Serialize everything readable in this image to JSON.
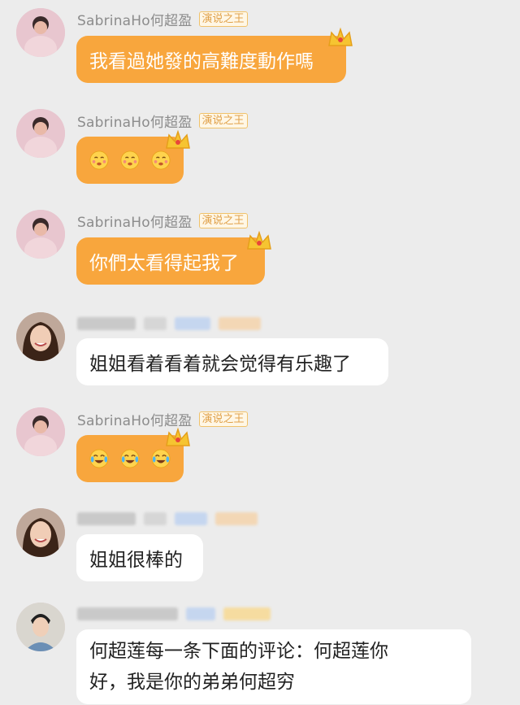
{
  "messages": [
    {
      "sender": "SabrinaHo何超盈",
      "badge": "演说之王",
      "text": "我看過她發的高難度動作嗎"
    },
    {
      "sender": "SabrinaHo何超盈",
      "badge": "演说之王",
      "emojis": [
        "blush-emoji",
        "blush-emoji",
        "blush-emoji"
      ]
    },
    {
      "sender": "SabrinaHo何超盈",
      "badge": "演说之王",
      "text": "你們太看得起我了"
    },
    {
      "text": "姐姐看着看着就会觉得有乐趣了"
    },
    {
      "sender": "SabrinaHo何超盈",
      "badge": "演说之王",
      "emojis": [
        "tears-of-joy-emoji",
        "tears-of-joy-emoji",
        "tears-of-joy-emoji"
      ]
    },
    {
      "text": "姐姐很棒的"
    },
    {
      "text_line1": "何超莲每一条下面的评论：何超莲你",
      "text_line2": "好，我是你的弟弟何超穷"
    }
  ],
  "colors": {
    "orange_bubble": "#f8a63d",
    "white_bubble": "#ffffff",
    "background": "#ececec",
    "badge": "#e0a14a"
  }
}
